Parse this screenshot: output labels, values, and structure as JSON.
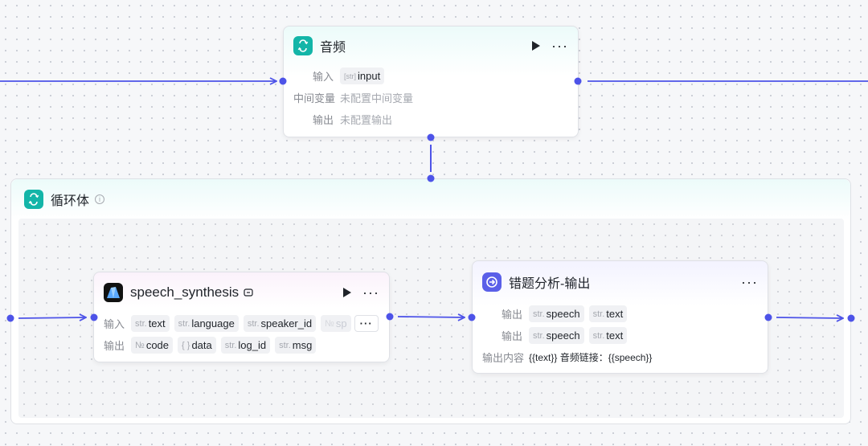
{
  "audio_node": {
    "title": "音频",
    "rows": [
      {
        "label": "输入",
        "chips": [
          {
            "type": "[str]",
            "name": "input"
          }
        ]
      },
      {
        "label": "中间变量",
        "text": "未配置中间变量"
      },
      {
        "label": "输出",
        "text": "未配置输出"
      }
    ]
  },
  "loop": {
    "title": "循环体",
    "info_icon": "info-icon"
  },
  "speech_node": {
    "title": "speech_synthesis",
    "badge_icon": "plugin-badge-icon",
    "input_label": "输入",
    "inputs": [
      {
        "type": "str.",
        "name": "text"
      },
      {
        "type": "str.",
        "name": "language"
      },
      {
        "type": "str.",
        "name": "speaker_id"
      },
      {
        "type": "№",
        "name": "sp"
      }
    ],
    "more_label": "···",
    "output_label": "输出",
    "outputs": [
      {
        "type": "№",
        "name": "code"
      },
      {
        "type": "{ }",
        "name": "data"
      },
      {
        "type": "str.",
        "name": "log_id"
      },
      {
        "type": "str.",
        "name": "msg"
      }
    ]
  },
  "output_node": {
    "title": "错题分析-输出",
    "rows": [
      {
        "label": "输出",
        "chips": [
          {
            "type": "str.",
            "name": "speech"
          },
          {
            "type": "str.",
            "name": "text"
          }
        ]
      },
      {
        "label": "输出",
        "chips": [
          {
            "type": "str.",
            "name": "speech"
          },
          {
            "type": "str.",
            "name": "text"
          }
        ]
      }
    ],
    "content_label": "输出内容",
    "content_value": "{{text}} 音频链接：{{speech}}"
  },
  "colors": {
    "accent": "#4d53e8",
    "teal_icon": "#13b5a8",
    "speech_icon_bg": "#111111",
    "output_icon_bg": "#5a5fe8"
  }
}
